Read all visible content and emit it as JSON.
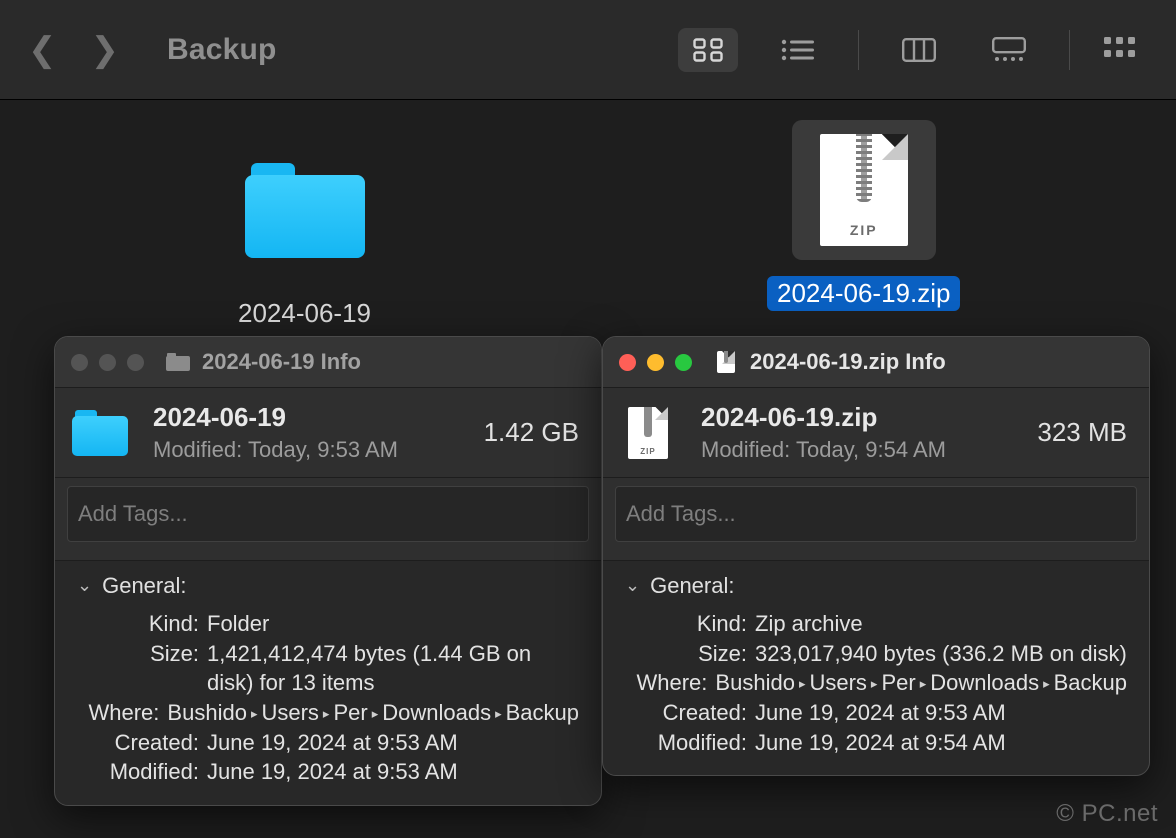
{
  "toolbar": {
    "title": "Backup"
  },
  "items": {
    "folder": {
      "label": "2024-06-19"
    },
    "zip": {
      "label": "2024-06-19.zip",
      "zip_tag": "ZIP"
    }
  },
  "panels": [
    {
      "active": false,
      "title": "2024-06-19 Info",
      "name": "2024-06-19",
      "modified_line": "Modified:  Today,  9:53 AM",
      "size": "1.42 GB",
      "tags_placeholder": "Add Tags...",
      "section_label": "General:",
      "rows": {
        "kind": {
          "k": "Kind:",
          "v": "Folder"
        },
        "size": {
          "k": "Size:",
          "v": "1,421,412,474 bytes (1.44 GB on disk) for 13 items"
        },
        "where": {
          "k": "Where:",
          "segments": [
            "Bushido",
            "Users",
            "Per",
            "Downloads",
            "Backup"
          ]
        },
        "created": {
          "k": "Created:",
          "v": "June 19, 2024 at 9:53 AM"
        },
        "modified": {
          "k": "Modified:",
          "v": "June 19, 2024 at 9:53 AM"
        }
      }
    },
    {
      "active": true,
      "title": "2024-06-19.zip Info",
      "name": "2024-06-19.zip",
      "modified_line": "Modified:  Today,  9:54 AM",
      "size": "323 MB",
      "tags_placeholder": "Add Tags...",
      "section_label": "General:",
      "rows": {
        "kind": {
          "k": "Kind:",
          "v": "Zip archive"
        },
        "size": {
          "k": "Size:",
          "v": "323,017,940 bytes (336.2 MB on disk)"
        },
        "where": {
          "k": "Where:",
          "segments": [
            "Bushido",
            "Users",
            "Per",
            "Downloads",
            "Backup"
          ]
        },
        "created": {
          "k": "Created:",
          "v": "June 19, 2024 at 9:53 AM"
        },
        "modified": {
          "k": "Modified:",
          "v": "June 19, 2024 at 9:54 AM"
        }
      }
    }
  ],
  "watermark": "© PC.net"
}
